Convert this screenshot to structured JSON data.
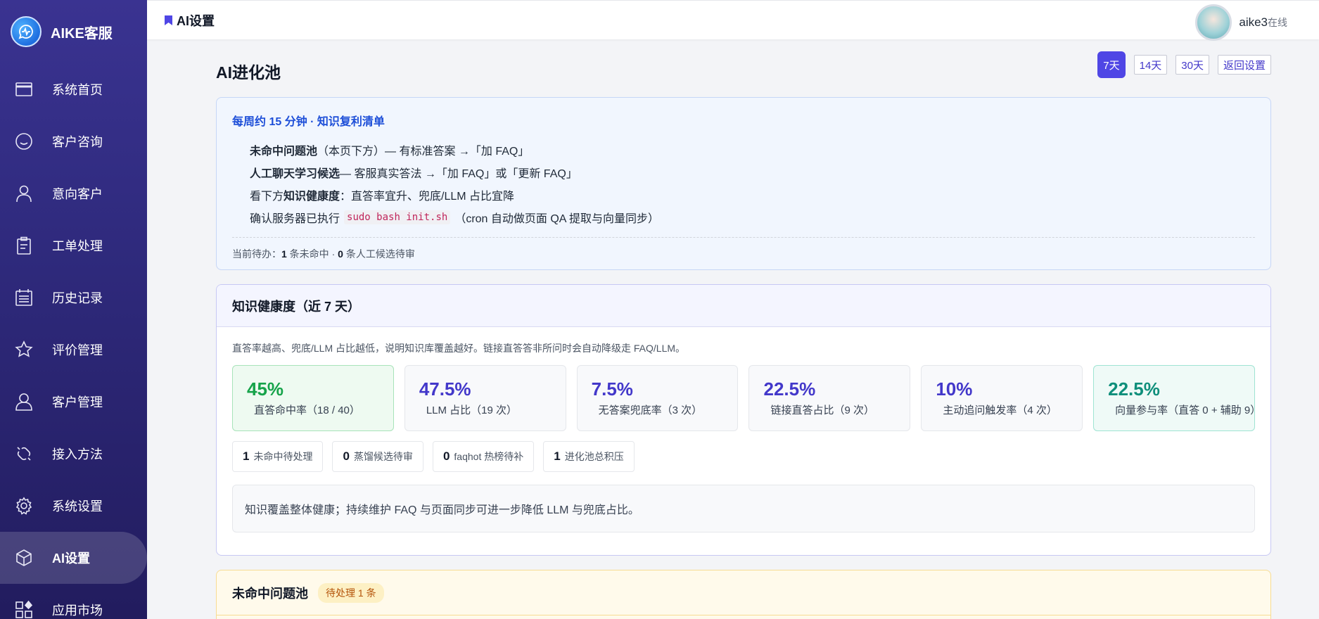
{
  "brand": {
    "name": "AIKE客服",
    "logo_icon": "chat-pulse-icon"
  },
  "sidebar": {
    "items": [
      {
        "label": "系统首页",
        "icon": "browser-window-icon",
        "active": false
      },
      {
        "label": "客户咨询",
        "icon": "smile-chat-icon",
        "active": false
      },
      {
        "label": "意向客户",
        "icon": "person-icon",
        "active": false
      },
      {
        "label": "工单处理",
        "icon": "clipboard-icon",
        "active": false
      },
      {
        "label": "历史记录",
        "icon": "calendar-list-icon",
        "active": false
      },
      {
        "label": "评价管理",
        "icon": "star-icon",
        "active": false
      },
      {
        "label": "客户管理",
        "icon": "person-outline-icon",
        "active": false
      },
      {
        "label": "接入方法",
        "icon": "link-puzzle-icon",
        "active": false
      },
      {
        "label": "系统设置",
        "icon": "gear-icon",
        "active": false
      },
      {
        "label": "AI设置",
        "icon": "cube-icon",
        "active": true
      },
      {
        "label": "应用市场",
        "icon": "apps-grid-icon",
        "active": false
      }
    ]
  },
  "header": {
    "breadcrumb": "AI设置",
    "user": {
      "name": "aike3",
      "status": "在线"
    }
  },
  "page": {
    "title": "AI进化池",
    "range_buttons": [
      "7天",
      "14天",
      "30天"
    ],
    "active_range": "7天",
    "back_button": "返回设置"
  },
  "guide": {
    "title": "每周约 15 分钟 · 知识复利清单",
    "item1": {
      "bold": "未命中问题池",
      "text": "（本页下方）— 有标准答案 →「加 FAQ」"
    },
    "item2": {
      "bold": "人工聊天学习候选",
      "text": " — 客服真实答法 →「加 FAQ」或「更新 FAQ」"
    },
    "item3": {
      "prefix": "看下方",
      "bold": "知识健康度",
      "text": "：直答率宜升、兜底/LLM 占比宜降"
    },
    "item4": {
      "prefix": "确认服务器已执行",
      "code": "sudo bash init.sh",
      "text": "（cron 自动做页面 QA 提取与向量同步）"
    },
    "footer": {
      "prefix": "当前待办：",
      "unmatched_count": "1",
      "unmatched_text": " 条未命中 · ",
      "review_count": "0",
      "review_text": " 条人工候选待审"
    }
  },
  "health": {
    "title": "知识健康度（近 7 天）",
    "description": "直答率越高、兜底/LLM 占比越低，说明知识库覆盖越好。链接直答答非所问时会自动降级走 FAQ/LLM。",
    "metrics": [
      {
        "value": "45%",
        "label": "直答命中率（18 / 40）",
        "style": "green"
      },
      {
        "value": "47.5%",
        "label": "LLM 占比（19 次）",
        "style": "plain"
      },
      {
        "value": "7.5%",
        "label": "无答案兜底率（3 次）",
        "style": "plain"
      },
      {
        "value": "22.5%",
        "label": "链接直答占比（9 次）",
        "style": "plain"
      },
      {
        "value": "10%",
        "label": "主动追问触发率（4 次）",
        "style": "plain"
      },
      {
        "value": "22.5%",
        "label": "向量参与率（直答 0 + 辅助 9）",
        "style": "teal"
      }
    ],
    "pills": [
      {
        "count": "1",
        "label": "未命中待处理"
      },
      {
        "count": "0",
        "label": "蒸馏候选待审"
      },
      {
        "count": "0",
        "label": "faqhot 热榜待补"
      },
      {
        "count": "1",
        "label": "进化池总积压"
      }
    ],
    "note": "知识覆盖整体健康；持续维护 FAQ 与页面同步可进一步降低 LLM 与兜底占比。"
  },
  "pool": {
    "title": "未命中问题池",
    "badge": "待处理 1 条"
  },
  "colors": {
    "sidebar_top": "#3a3391",
    "sidebar_bottom": "#221c5e",
    "accent": "#4f46e5",
    "guide_title": "#1d4ed8",
    "metric_green": "#16a34a",
    "metric_teal": "#0f8f7b",
    "metric_indigo": "#4338ca",
    "badge_text": "#b45309"
  }
}
